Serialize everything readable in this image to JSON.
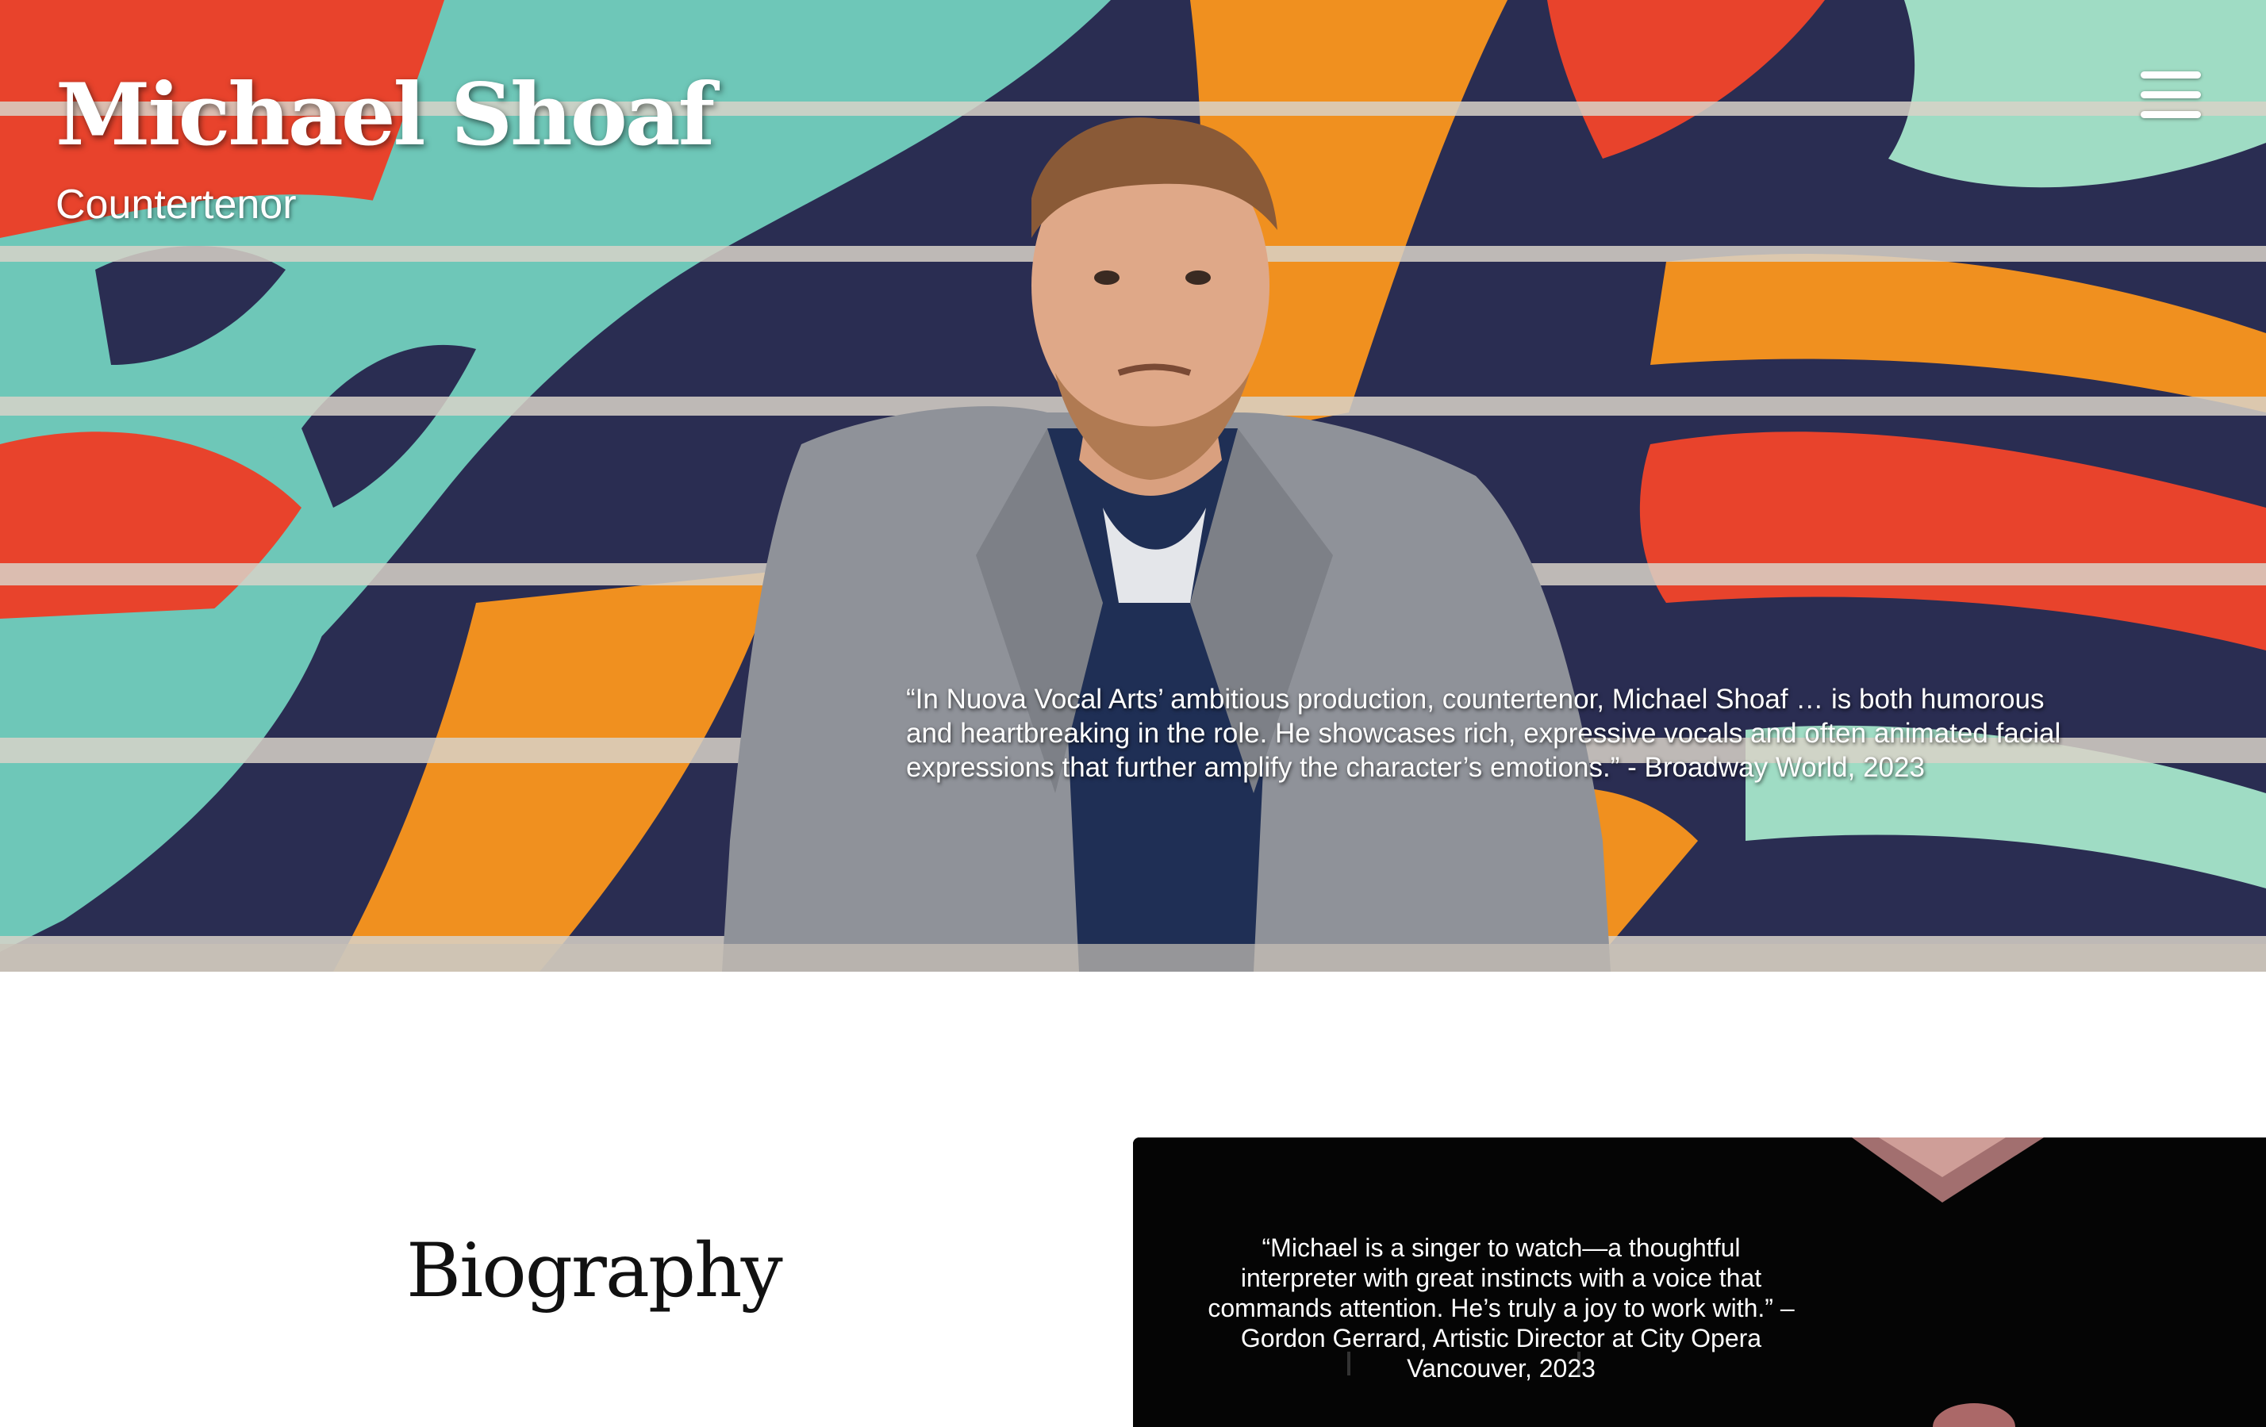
{
  "header": {
    "site_title": "Michael Shoaf",
    "tagline": "Countertenor",
    "menu_icon": "hamburger-menu-icon"
  },
  "hero": {
    "quote": "“In Nuova Vocal Arts’ ambitious production, countertenor, Michael Shoaf … is both humorous and heartbreaking in the role. He showcases rich, expressive vocals and often animated facial expressions that further amplify the character’s emotions.” - Broadway World, 2023",
    "mural_colors": [
      "#e8432c",
      "#f0901f",
      "#6ec7b8",
      "#2a2d52",
      "#9fdcc4"
    ]
  },
  "biography": {
    "heading": "Biography",
    "card_quote": "“Michael is a singer to watch—a thoughtful interpreter with great instincts with a voice that commands attention. He’s truly a joy to work with.” – Gordon Gerrard, Artistic Director at City Opera Vancouver, 2023"
  }
}
